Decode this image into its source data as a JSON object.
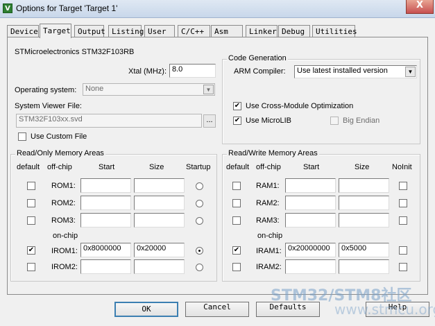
{
  "window": {
    "title": "Options for Target 'Target 1'",
    "close": "X",
    "icon_text": "V"
  },
  "tabs": [
    "Device",
    "Target",
    "Output",
    "Listing",
    "User",
    "C/C++",
    "Asm",
    "Linker",
    "Debug",
    "Utilities"
  ],
  "active_tab": "Target",
  "device": "STMicroelectronics STM32F103RB",
  "xtal": {
    "label": "Xtal (MHz):",
    "value": "8.0"
  },
  "os": {
    "label": "Operating system:",
    "value": "None"
  },
  "svf": {
    "label": "System Viewer File:",
    "value": "STM32F103xx.svd",
    "browse": "..."
  },
  "custom_file": {
    "label": "Use Custom File",
    "checked": false
  },
  "code_gen": {
    "title": "Code Generation",
    "compiler_label": "ARM Compiler:",
    "compiler_value": "Use latest installed version",
    "cross_module": {
      "label": "Use Cross-Module Optimization",
      "checked": true
    },
    "microlib": {
      "label": "Use MicroLIB",
      "checked": true
    },
    "big_endian": {
      "label": "Big Endian",
      "checked": false
    }
  },
  "rom": {
    "title": "Read/Only Memory Areas",
    "headers": {
      "default": "default",
      "offchip": "off-chip",
      "start": "Start",
      "size": "Size",
      "startup": "Startup"
    },
    "onchip_label": "on-chip",
    "rows": [
      {
        "name": "ROM1:",
        "start": "",
        "size": "",
        "default": false,
        "startup": false
      },
      {
        "name": "ROM2:",
        "start": "",
        "size": "",
        "default": false,
        "startup": false
      },
      {
        "name": "ROM3:",
        "start": "",
        "size": "",
        "default": false,
        "startup": false
      },
      {
        "name": "IROM1:",
        "start": "0x8000000",
        "size": "0x20000",
        "default": true,
        "startup": true
      },
      {
        "name": "IROM2:",
        "start": "",
        "size": "",
        "default": false,
        "startup": false
      }
    ]
  },
  "ram": {
    "title": "Read/Write Memory Areas",
    "headers": {
      "default": "default",
      "offchip": "off-chip",
      "start": "Start",
      "size": "Size",
      "noinit": "NoInit"
    },
    "onchip_label": "on-chip",
    "rows": [
      {
        "name": "RAM1:",
        "start": "",
        "size": "",
        "default": false,
        "noinit": false
      },
      {
        "name": "RAM2:",
        "start": "",
        "size": "",
        "default": false,
        "noinit": false
      },
      {
        "name": "RAM3:",
        "start": "",
        "size": "",
        "default": false,
        "noinit": false
      },
      {
        "name": "IRAM1:",
        "start": "0x20000000",
        "size": "0x5000",
        "default": true,
        "noinit": false
      },
      {
        "name": "IRAM2:",
        "start": "",
        "size": "",
        "default": false,
        "noinit": false
      }
    ]
  },
  "buttons": {
    "ok": "OK",
    "cancel": "Cancel",
    "defaults": "Defaults",
    "help": "Help"
  },
  "watermark": {
    "line1": "STM32/STM8社区",
    "line2": "www.stmcu.org"
  }
}
